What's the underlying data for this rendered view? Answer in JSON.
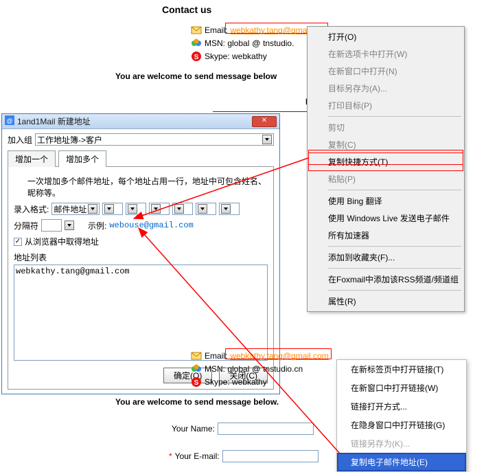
{
  "contact": {
    "heading": "Contact us",
    "email_label": "Email:",
    "email_value": "webkathy.tang@gmail.com",
    "msn_label": "MSN: global",
    "msn_domain": "tnstudio.",
    "msn_domain_full": "tnstudio.cn",
    "skype_label": "Skype: webkathy",
    "welcome": "You are welcome to send message below",
    "welcome_full": "You are welcome to send message below.",
    "letter_m": "M"
  },
  "ctxmenu1": {
    "open": "打开(O)",
    "open_tab": "在新选项卡中打开(W)",
    "open_win": "在新窗口中打开(N)",
    "save_target": "目标另存为(A)...",
    "print_target": "打印目标(P)",
    "cut": "剪切",
    "copy": "复制(C)",
    "copy_shortcut": "复制快捷方式(T)",
    "paste": "粘贴(P)",
    "bing": "使用 Bing 翻译",
    "windowslive": "使用 Windows Live 发送电子邮件",
    "accel": "所有加速器",
    "fav": "添加到收藏夹(F)...",
    "foxmail": "在Foxmail中添加该RSS频道/频道组",
    "prop": "属性(R)"
  },
  "dialog": {
    "title": "1and1Mail 新建地址",
    "group_label": "加入组",
    "group_value": "工作地址簿->客户",
    "tab_addone": "增加一个",
    "tab_addmany": "增加多个",
    "note": "一次增加多个邮件地址，每个地址占用一行，地址中可包含姓名、昵称等。",
    "format_label": "录入格式:",
    "format_value": "邮件地址",
    "sep_label": "分隔符",
    "example_label": "示例:",
    "example_value": "webouse@gmail.com",
    "browser_cb": "从浏览器中取得地址",
    "addrlist_label": "地址列表",
    "address_content": "webkathy.tang@gmail.com",
    "ok": "确定(O)",
    "close": "关闭(C)"
  },
  "ctxmenu2": {
    "open_tab": "在新标签页中打开链接(T)",
    "open_win": "在新窗口中打开链接(W)",
    "open_mode": "链接打开方式...",
    "open_incognito": "在隐身窗口中打开链接(G)",
    "save_as": "链接另存为(K)...",
    "copy_email": "复制电子邮件地址(E)"
  },
  "form": {
    "name_label": "Your Name:",
    "email_label": "Your E-mail:",
    "email_required": "*"
  }
}
